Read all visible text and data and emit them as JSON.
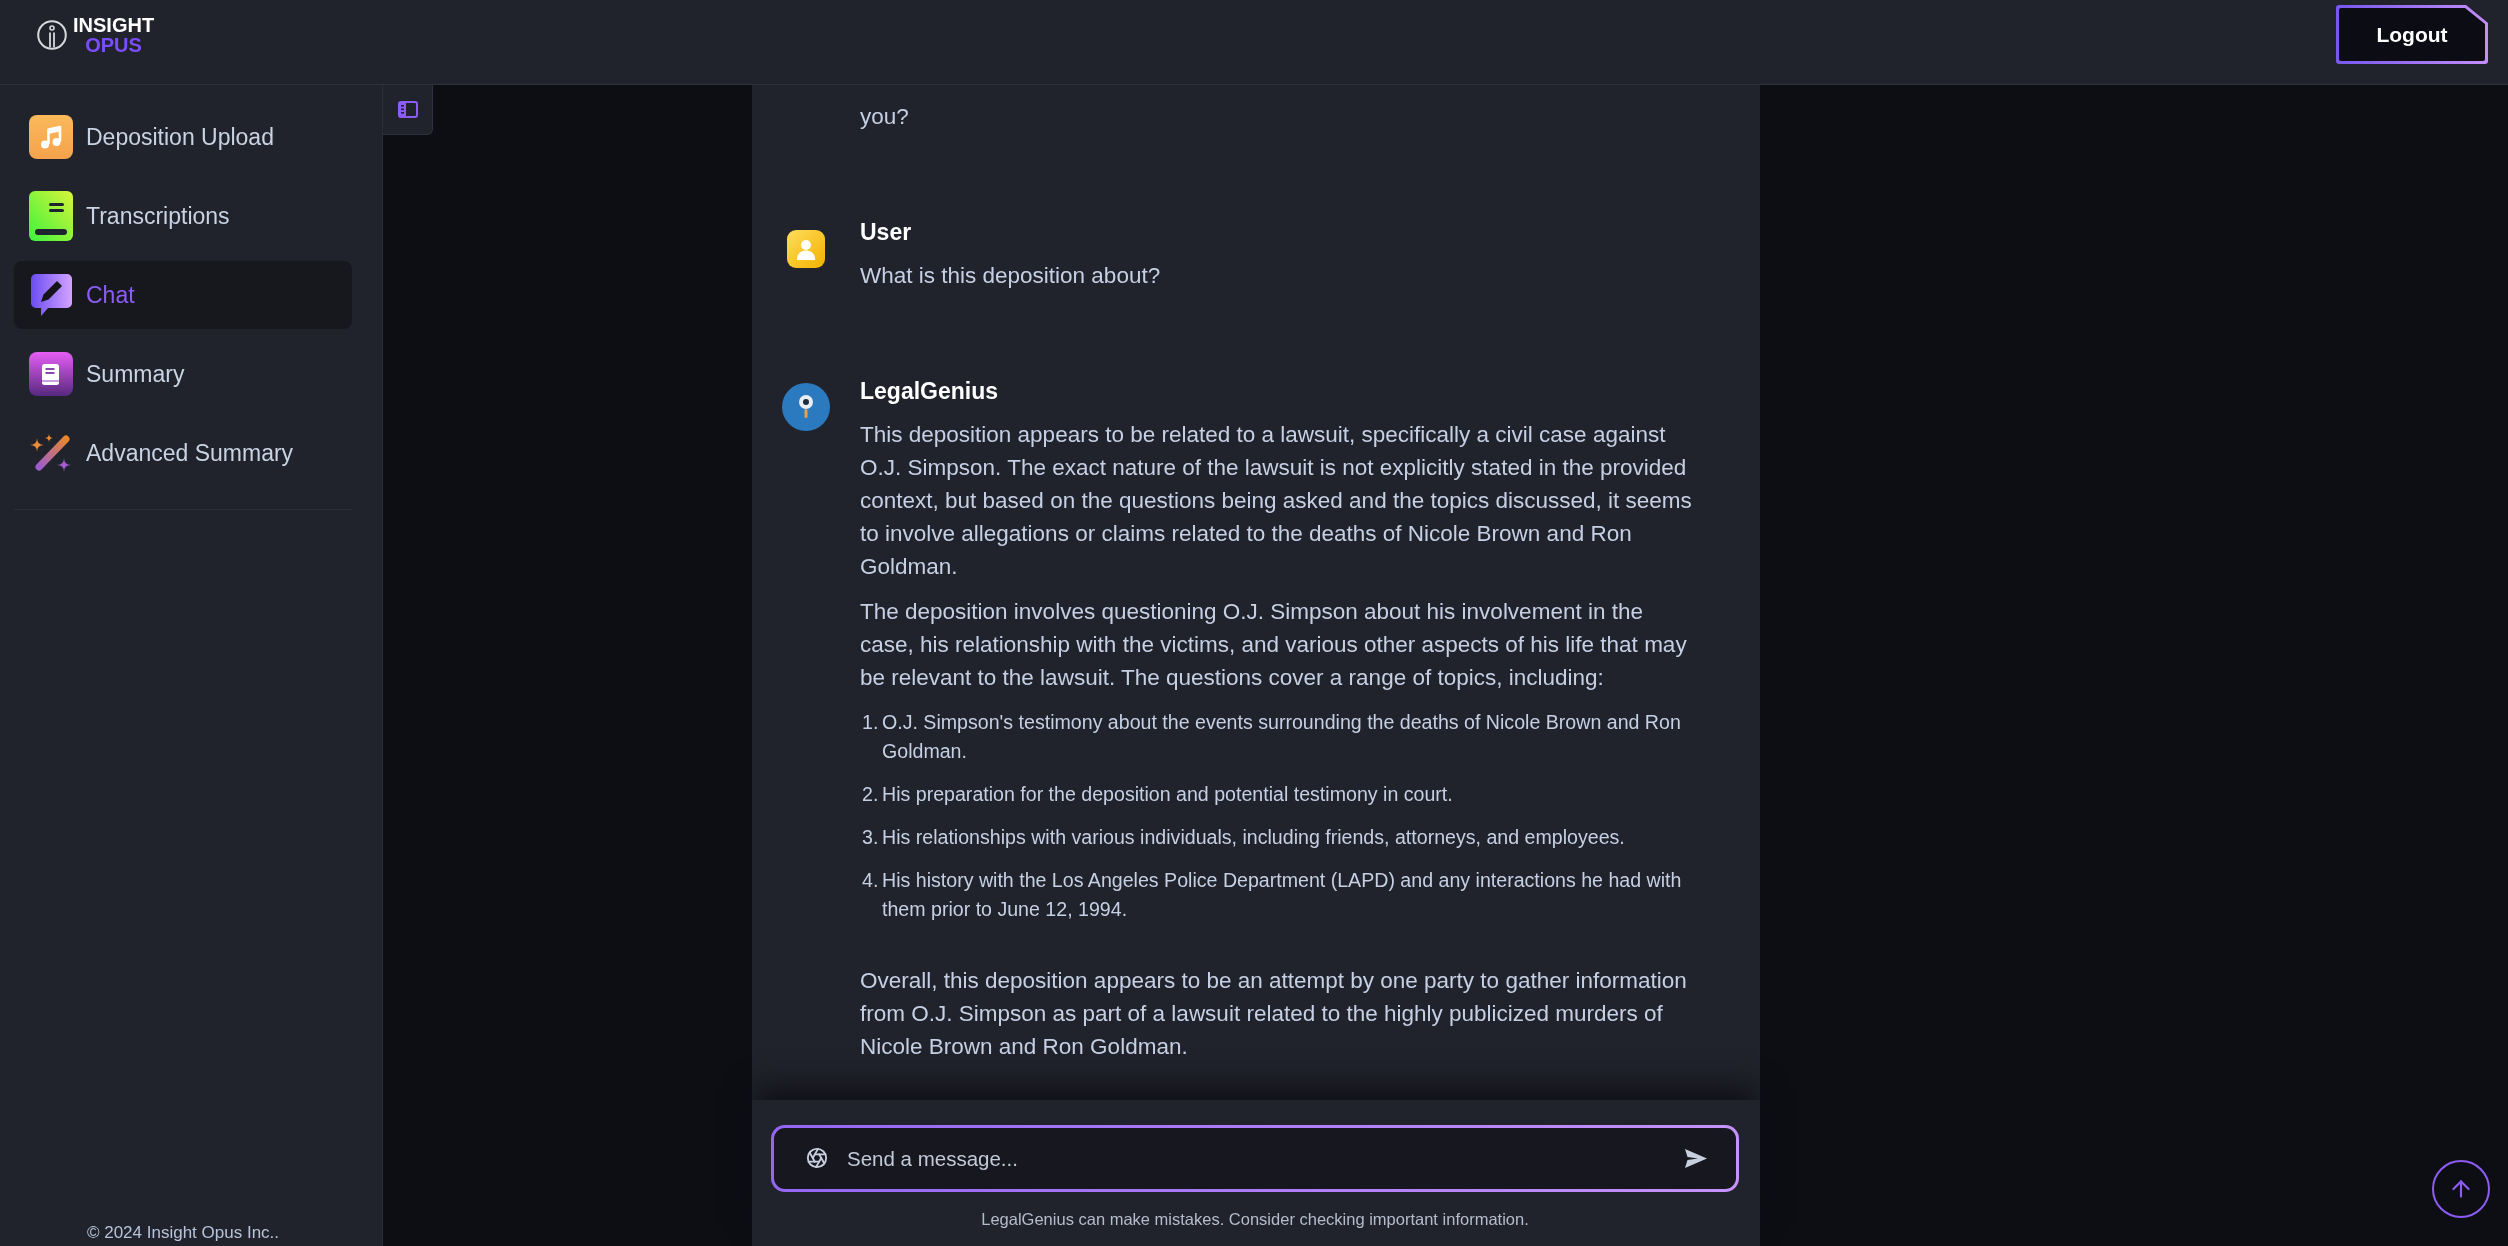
{
  "header": {
    "logo": {
      "line_1": "INSIGHT",
      "line_2": "OPUS"
    },
    "logout_button": "Logout"
  },
  "sidebar": {
    "items": [
      {
        "label": "Deposition Upload",
        "selected": false
      },
      {
        "label": "Transcriptions",
        "selected": false
      },
      {
        "label": "Chat",
        "selected": true
      },
      {
        "label": "Summary",
        "selected": false
      },
      {
        "label": "Advanced Summary",
        "selected": false
      }
    ],
    "footer": "© 2024 Insight Opus Inc.."
  },
  "chat": {
    "messages": [
      {
        "blocks": [
          {
            "kind": "paragraph",
            "text": "you?"
          }
        ]
      },
      {
        "kind": "user",
        "name": "User",
        "blocks": [
          {
            "kind": "paragraph",
            "text": "What is this deposition about?"
          }
        ]
      },
      {
        "kind": "assistant",
        "name": "LegalGenius",
        "blocks": [
          {
            "kind": "paragraph",
            "text": "This deposition appears to be related to a lawsuit, specifically a civil case against O.J. Simpson. The exact nature of the lawsuit is not explicitly stated in the provided context, but based on the questions being asked and the topics discussed, it seems to involve allegations or claims related to the deaths of Nicole Brown and Ron Goldman."
          },
          {
            "kind": "paragraph",
            "text": "The deposition involves questioning O.J. Simpson about his involvement in the case, his relationship with the victims, and various other aspects of his life that may be relevant to the lawsuit. The questions cover a range of topics, including:"
          },
          {
            "kind": "list",
            "items": [
              {
                "number": "1.",
                "text": "O.J. Simpson's testimony about the events surrounding the deaths of Nicole Brown and Ron Goldman."
              },
              {
                "number": "2.",
                "text": "His preparation for the deposition and potential testimony in court."
              },
              {
                "number": "3.",
                "text": "His relationships with various individuals, including friends, attorneys, and employees."
              },
              {
                "number": "4.",
                "text": "His history with the Los Angeles Police Department (LAPD) and any interactions he had with them prior to June 12, 1994."
              }
            ]
          },
          {
            "kind": "paragraph",
            "text": "Overall, this deposition appears to be an attempt by one party to gather information from O.J. Simpson as part of a lawsuit related to the highly publicized murders of Nicole Brown and Ron Goldman."
          }
        ]
      }
    ],
    "composer": {
      "placeholder": "Send a message..."
    },
    "disclaimer": "LegalGenius can make mistakes. Consider checking important information."
  }
}
